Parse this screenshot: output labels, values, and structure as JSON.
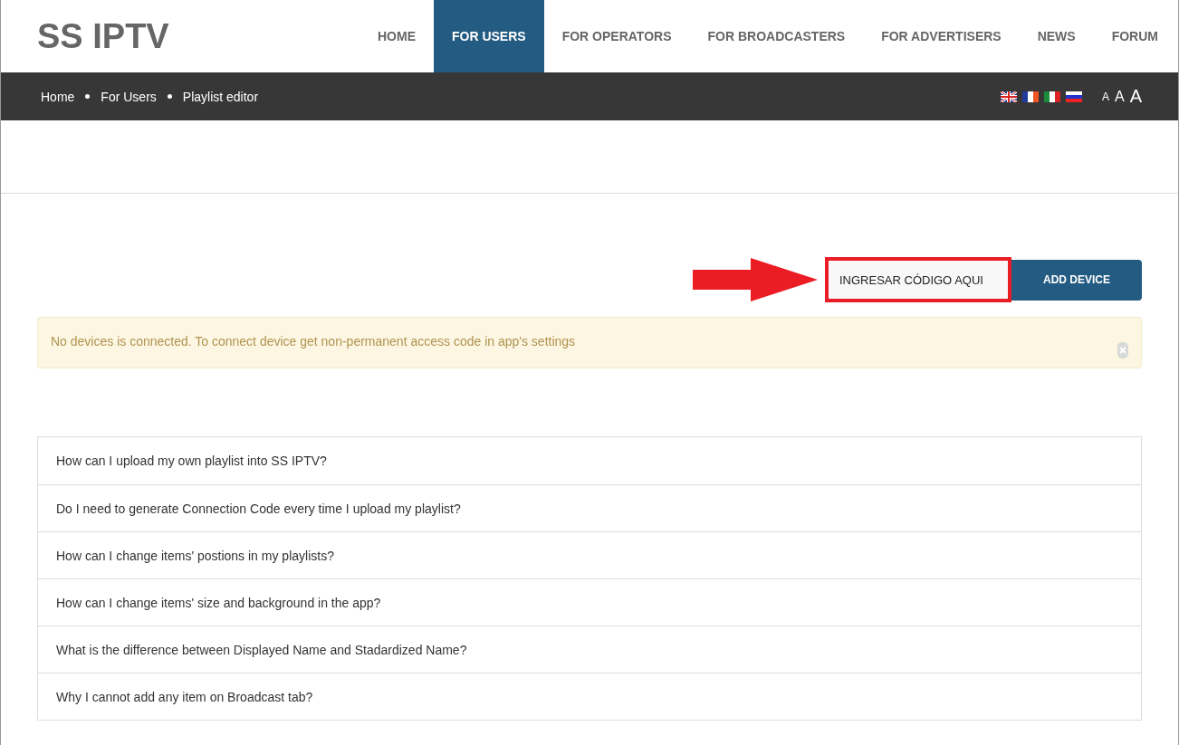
{
  "logo": "SS IPTV",
  "nav": [
    {
      "label": "HOME",
      "selected": false
    },
    {
      "label": "FOR USERS",
      "selected": true
    },
    {
      "label": "FOR OPERATORS",
      "selected": false
    },
    {
      "label": "FOR BROADCASTERS",
      "selected": false
    },
    {
      "label": "FOR ADVERTISERS",
      "selected": false
    },
    {
      "label": "NEWS",
      "selected": false
    },
    {
      "label": "FORUM",
      "selected": false
    }
  ],
  "breadcrumb": [
    "Home",
    "For Users",
    "Playlist editor"
  ],
  "languages": [
    {
      "kind": "uk"
    },
    {
      "kind": "fr"
    },
    {
      "kind": "it"
    },
    {
      "kind": "ru"
    }
  ],
  "font_sizes": [
    "A",
    "A",
    "A"
  ],
  "device_form": {
    "value": "INGRESAR CÓDIGO AQUI",
    "button": "ADD DEVICE"
  },
  "alert": {
    "text": "No devices is connected. To connect device get non-permanent access code in app's settings"
  },
  "faq": [
    "How can I upload my own playlist into SS IPTV?",
    "Do I need to generate Connection Code every time I upload my playlist?",
    "How can I change items' postions in my playlists?",
    "How can I change items' size and background in the app?",
    "What is the difference between Displayed Name and Stadardized Name?",
    "Why I cannot add any item on Broadcast tab?"
  ]
}
